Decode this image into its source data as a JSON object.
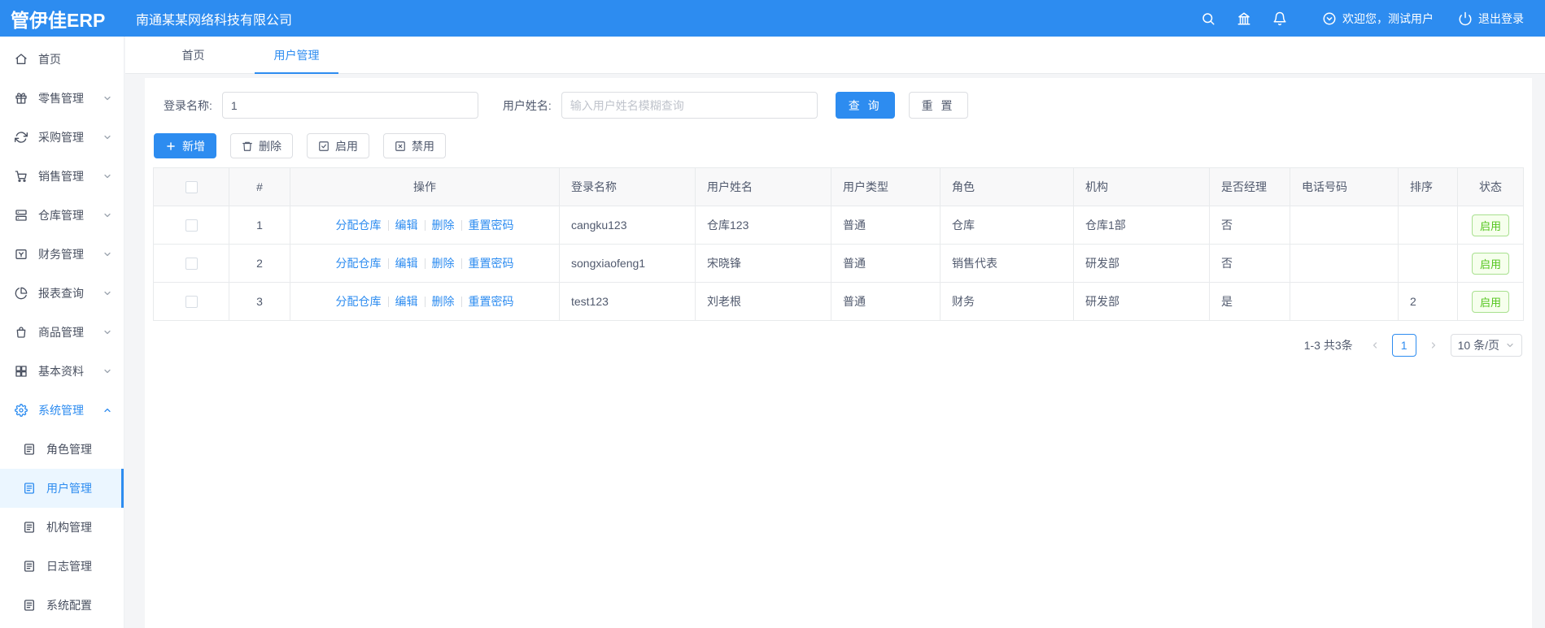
{
  "header": {
    "logo": "管伊佳ERP",
    "company": "南通某某网络科技有限公司",
    "icons": [
      "search-icon",
      "bank-icon",
      "bell-icon",
      "user-dropdown-icon",
      "logout-icon"
    ],
    "welcome": "欢迎您，测试用户",
    "logout": "退出登录"
  },
  "sidebar": {
    "items": [
      {
        "label": "首页",
        "icon": "home-icon"
      },
      {
        "label": "零售管理",
        "icon": "gift-icon"
      },
      {
        "label": "采购管理",
        "icon": "sync-icon"
      },
      {
        "label": "销售管理",
        "icon": "cart-icon"
      },
      {
        "label": "仓库管理",
        "icon": "warehouse-icon"
      },
      {
        "label": "财务管理",
        "icon": "finance-icon"
      },
      {
        "label": "报表查询",
        "icon": "pie-chart-icon"
      },
      {
        "label": "商品管理",
        "icon": "bag-icon"
      },
      {
        "label": "基本资料",
        "icon": "grid-icon"
      },
      {
        "label": "系统管理",
        "icon": "gear-icon"
      }
    ],
    "sub_items": [
      {
        "label": "角色管理",
        "icon": "doc-icon"
      },
      {
        "label": "用户管理",
        "icon": "doc-icon"
      },
      {
        "label": "机构管理",
        "icon": "doc-icon"
      },
      {
        "label": "日志管理",
        "icon": "doc-icon"
      },
      {
        "label": "系统配置",
        "icon": "doc-icon"
      }
    ]
  },
  "tabs": {
    "home": "首页",
    "current": "用户管理"
  },
  "search": {
    "login_label": "登录名称:",
    "login_value": "1",
    "name_label": "用户姓名:",
    "name_placeholder": "输入用户姓名模糊查询",
    "query_btn": "查 询",
    "reset_btn": "重 置"
  },
  "toolbar": {
    "add": "新增",
    "delete": "删除",
    "enable": "启用",
    "disable": "禁用"
  },
  "table": {
    "headers": {
      "index": "#",
      "ops": "操作",
      "login": "登录名称",
      "name": "用户姓名",
      "type": "用户类型",
      "role": "角色",
      "org": "机构",
      "manager": "是否经理",
      "phone": "电话号码",
      "sort": "排序",
      "status": "状态"
    },
    "op_links": {
      "assign": "分配仓库",
      "edit": "编辑",
      "del": "删除",
      "reset_pwd": "重置密码"
    },
    "rows": [
      {
        "index": "1",
        "login": "cangku123",
        "name": "仓库123",
        "type": "普通",
        "role": "仓库",
        "org": "仓库1部",
        "manager": "否",
        "phone": "",
        "sort": "",
        "status": "启用"
      },
      {
        "index": "2",
        "login": "songxiaofeng1",
        "name": "宋晓锋",
        "type": "普通",
        "role": "销售代表",
        "org": "研发部",
        "manager": "否",
        "phone": "",
        "sort": "",
        "status": "启用"
      },
      {
        "index": "3",
        "login": "test123",
        "name": "刘老根",
        "type": "普通",
        "role": "财务",
        "org": "研发部",
        "manager": "是",
        "phone": "",
        "sort": "2",
        "status": "启用"
      }
    ]
  },
  "pagination": {
    "total": "1-3 共3条",
    "page": "1",
    "page_size": "10 条/页"
  },
  "colors": {
    "primary": "#2d8cf0",
    "success": "#52c41a",
    "header_bg": "#2d8cf0"
  }
}
